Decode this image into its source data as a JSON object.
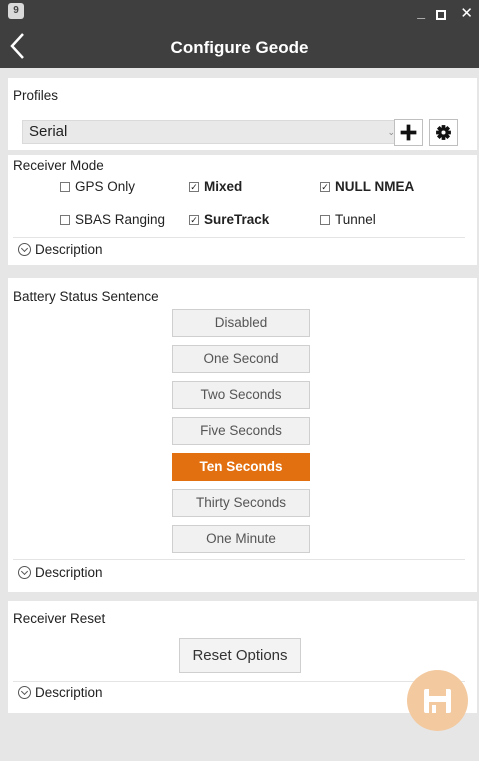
{
  "window": {
    "icon_label": "9",
    "title": "Configure Geode"
  },
  "profiles": {
    "label": "Profiles",
    "selected": "Serial"
  },
  "receiver_mode": {
    "label": "Receiver Mode",
    "options": [
      {
        "label": "GPS Only",
        "checked": false
      },
      {
        "label": "Mixed",
        "checked": true
      },
      {
        "label": "NULL NMEA",
        "checked": true
      },
      {
        "label": "SBAS Ranging",
        "checked": false
      },
      {
        "label": "SureTrack",
        "checked": true
      },
      {
        "label": "Tunnel",
        "checked": false
      }
    ],
    "description_label": "Description"
  },
  "battery": {
    "label": "Battery Status Sentence",
    "options": [
      "Disabled",
      "One Second",
      "Two Seconds",
      "Five Seconds",
      "Ten Seconds",
      "Thirty Seconds",
      "One Minute"
    ],
    "selected": "Ten Seconds",
    "description_label": "Description"
  },
  "reset": {
    "label": "Receiver Reset",
    "button_label": "Reset Options",
    "description_label": "Description"
  },
  "colors": {
    "accent": "#e27010",
    "titlebar": "#3f3f3f",
    "fab": "#f3c9a0"
  }
}
